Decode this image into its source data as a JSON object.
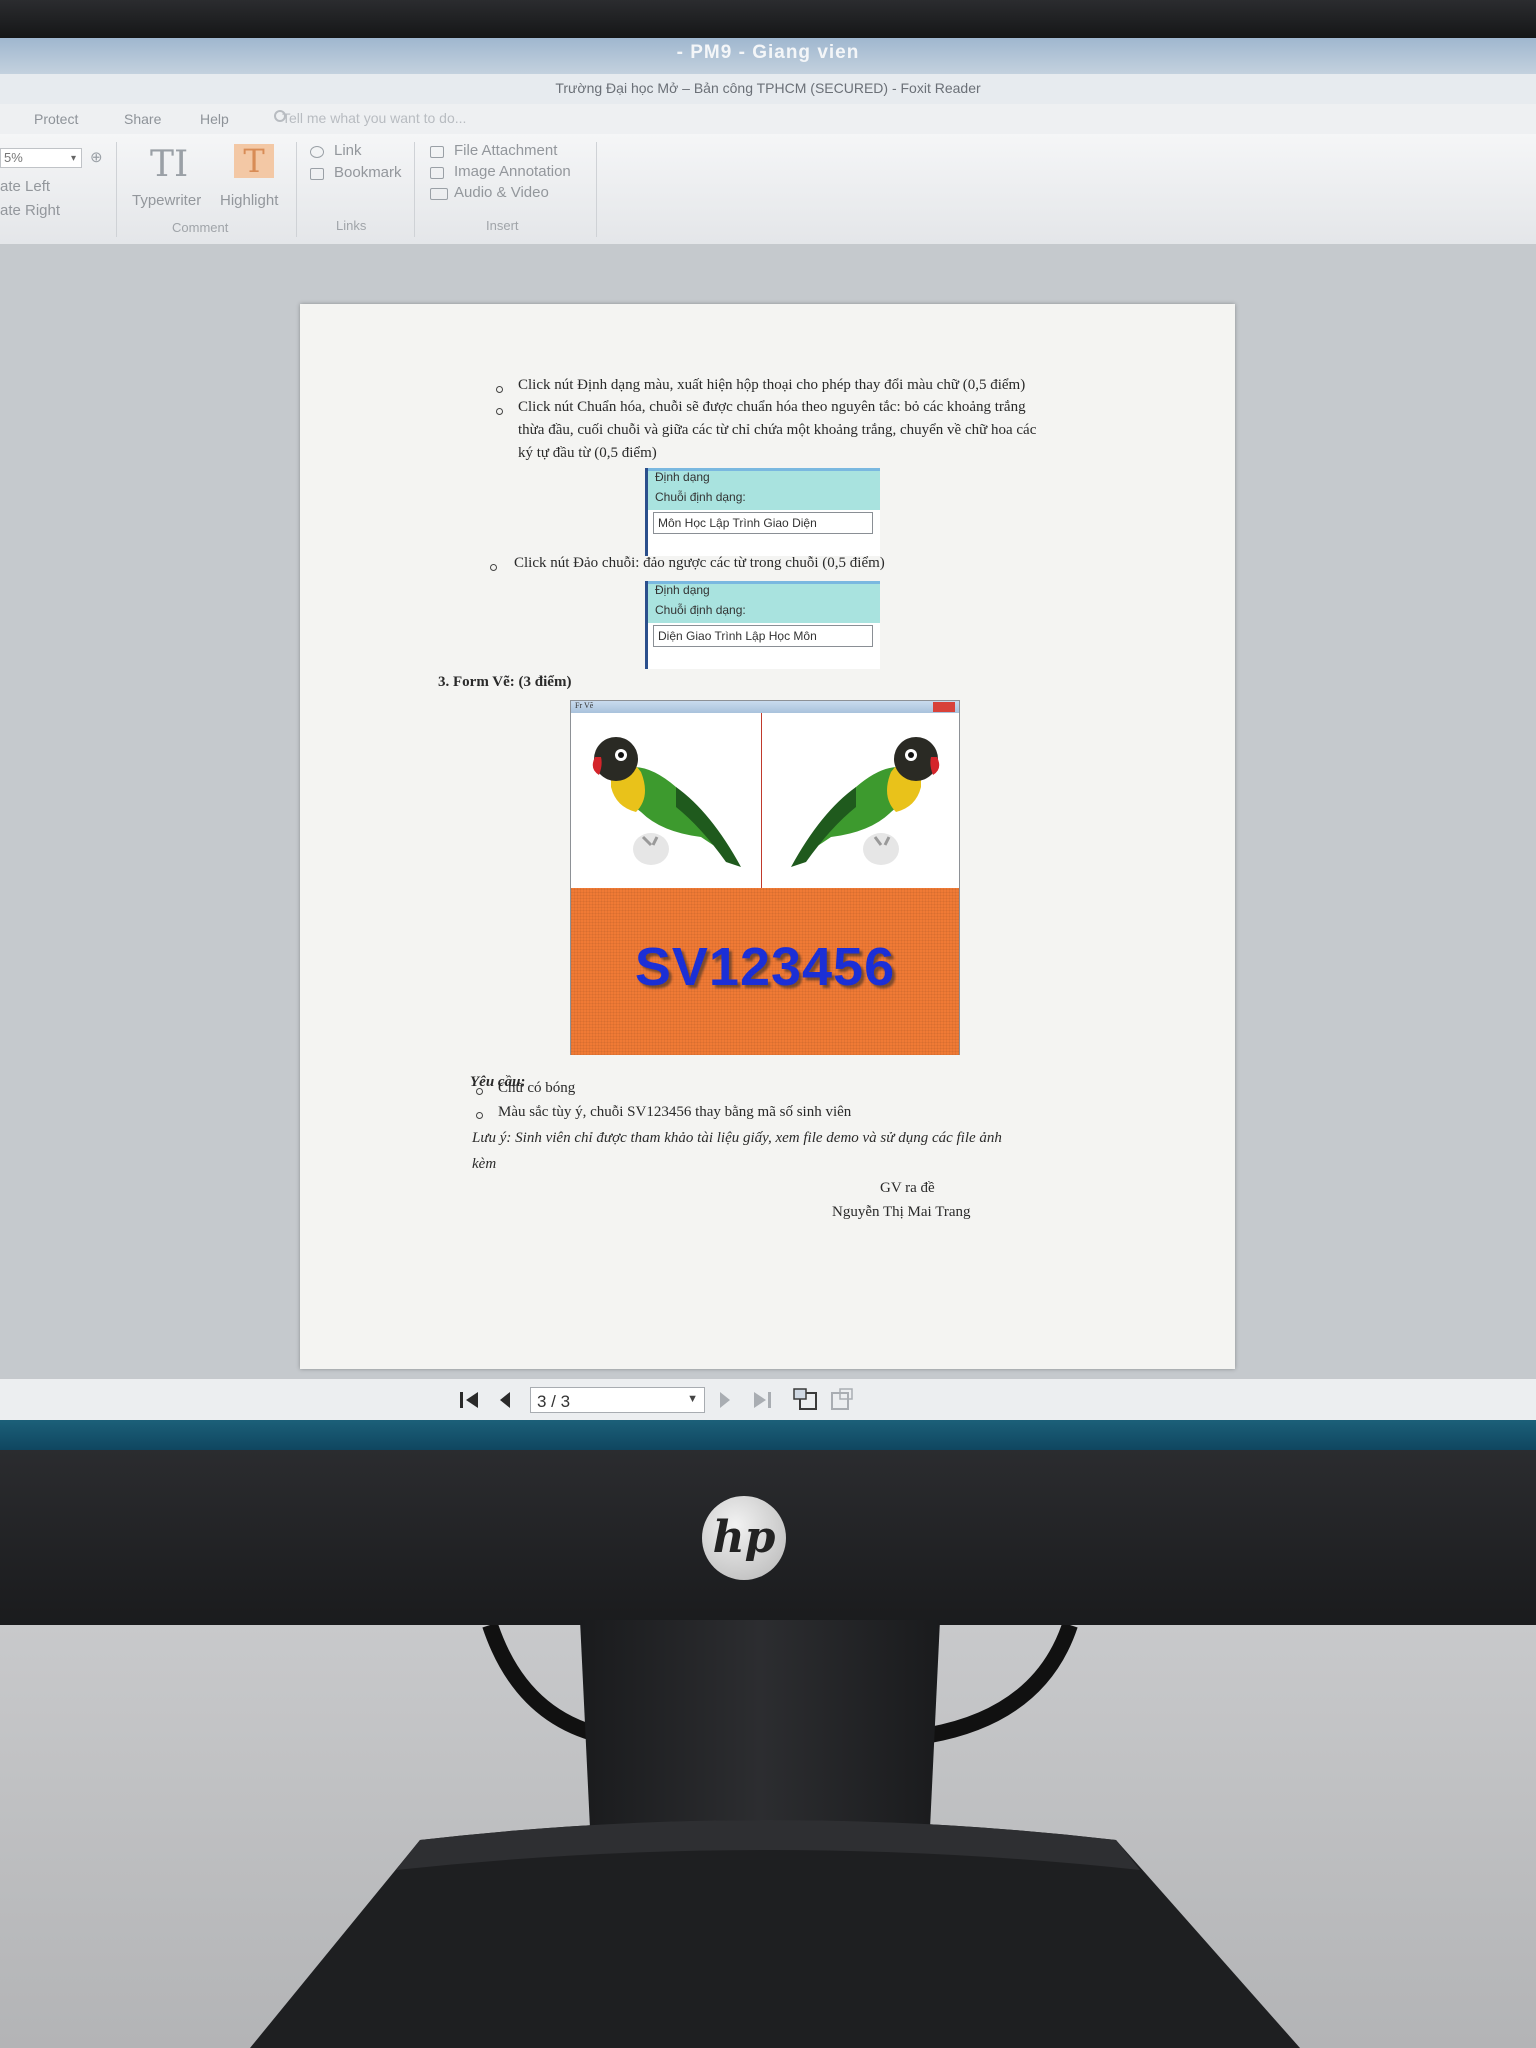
{
  "window": {
    "title": "- PM9 - Giang vien",
    "doc_title": "Trường Đại học Mở – Bản công TPHCM  (SECURED) - Foxit Reader"
  },
  "ribbon": {
    "tabs": [
      "Protect",
      "Share",
      "Help"
    ],
    "tell_me_placeholder": "Tell me what you want to do...",
    "zoom_value": "5%",
    "rotate_left": "ate Left",
    "rotate_right": "ate Right",
    "typewriter_label": "Typewriter",
    "highlight_label": "Highlight",
    "comment_group": "Comment",
    "link_label": "Link",
    "bookmark_label": "Bookmark",
    "links_group": "Links",
    "file_attachment_label": "File Attachment",
    "image_annotation_label": "Image Annotation",
    "audio_video_label": "Audio & Video",
    "insert_group": "Insert"
  },
  "document": {
    "bullet1": "Click nút Định dạng màu, xuất hiện hộp thoại cho phép thay đổi màu chữ (0,5 điểm)",
    "bullet2_line1": "Click nút Chuẩn hóa, chuỗi sẽ được chuẩn hóa theo nguyên tắc: bỏ các khoảng trắng",
    "bullet2_line2": "thừa đầu, cuối chuỗi và giữa các từ chỉ chứa một khoảng trắng, chuyển về chữ hoa các",
    "bullet2_line3": "ký tự đầu từ (0,5 điểm)",
    "form1": {
      "title": "Định dạng",
      "label": "Chuỗi định dạng:",
      "value": "Môn Học Lập Trình Giao Diện"
    },
    "bullet3": "Click nút Đảo chuỗi: đảo ngược các từ trong chuỗi (0,5 điểm)",
    "form2": {
      "title": "Định dạng",
      "label": "Chuỗi định dạng:",
      "value": "Diện Giao Trình Lập Học Môn"
    },
    "section3": "3.  Form Vẽ: (3 điểm)",
    "form_ve_caption": "Fr Vẽ",
    "form_ve_text": "SV123456",
    "yeu_cau": "Yêu cầu:",
    "req1": "Chữ có bóng",
    "req2": "Màu sắc tùy ý, chuỗi SV123456 thay bằng mã số sinh viên",
    "note_line1": "Lưu ý: Sinh viên chỉ được tham khảo tài liệu giấy, xem file demo và sử dụng các file ảnh",
    "note_line2": "kèm",
    "sign1": "GV ra đề",
    "sign2": "Nguyễn Thị Mai Trang"
  },
  "navigation": {
    "page_value": "3 / 3"
  },
  "monitor": {
    "brand": "hp"
  },
  "colors": {
    "orange_panel": "#f07a35",
    "sv_text": "#1b2fd6",
    "form_header": "#a9e3df"
  }
}
